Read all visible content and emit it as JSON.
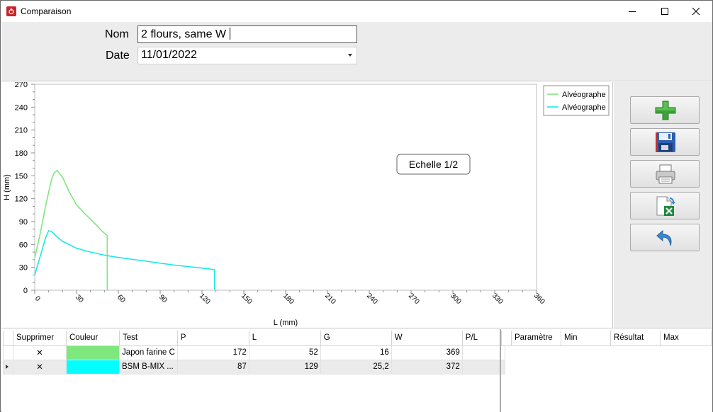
{
  "window": {
    "title": "Comparaison"
  },
  "form": {
    "nom_label": "Nom",
    "nom_value": "2 flours, same W",
    "date_label": "Date",
    "date_value": "11/01/2022"
  },
  "chart_data": {
    "type": "line",
    "xlabel": "L (mm)",
    "ylabel": "H (mm)",
    "xlim": [
      0,
      360
    ],
    "ylim": [
      0,
      270
    ],
    "x_ticks": [
      "0",
      "30",
      "60",
      "90",
      "120",
      "150",
      "180",
      "210",
      "240",
      "270",
      "300",
      "330",
      "360"
    ],
    "y_ticks": [
      "0",
      "30",
      "60",
      "90",
      "120",
      "150",
      "180",
      "210",
      "240",
      "270"
    ],
    "annotation": "Echelle 1/2",
    "legend_position": "top-right",
    "series": [
      {
        "name": "Alvéographe",
        "color": "#7ee87e",
        "x": [
          0,
          4,
          8,
          12,
          14,
          16,
          20,
          25,
          30,
          35,
          40,
          45,
          48,
          51,
          52,
          52
        ],
        "y": [
          42,
          75,
          112,
          145,
          154,
          157,
          148,
          128,
          112,
          102,
          93,
          84,
          78,
          73,
          72,
          0
        ]
      },
      {
        "name": "Alvéographe",
        "color": "#1ee8e8",
        "x": [
          0,
          4,
          8,
          10,
          12,
          16,
          20,
          30,
          40,
          50,
          60,
          80,
          100,
          120,
          129,
          129
        ],
        "y": [
          20,
          45,
          70,
          78,
          77,
          70,
          64,
          55,
          50,
          46,
          43,
          38,
          33,
          29,
          27,
          0
        ]
      }
    ]
  },
  "actions": {
    "add": "plus-icon",
    "save": "floppy-disk-icon",
    "print": "printer-icon",
    "export": "excel-export-icon",
    "back": "undo-arrow-icon"
  },
  "table": {
    "headers": [
      "Supprimer",
      "Couleur",
      "Test",
      "P",
      "L",
      "G",
      "W",
      "P/L"
    ],
    "rows": [
      {
        "supprimer": "✕",
        "color": "#7ee87e",
        "test": "Japon farine C",
        "P": "172",
        "L": "52",
        "G": "16",
        "W": "369",
        "PL": ""
      },
      {
        "supprimer": "✕",
        "color": "#00ffff",
        "test": "BSM B-MIX ...",
        "P": "87",
        "L": "129",
        "G": "25,2",
        "W": "372",
        "PL": ""
      }
    ]
  },
  "params_table": {
    "headers": [
      "Paramètre",
      "Min",
      "Résultat",
      "Max"
    ]
  }
}
